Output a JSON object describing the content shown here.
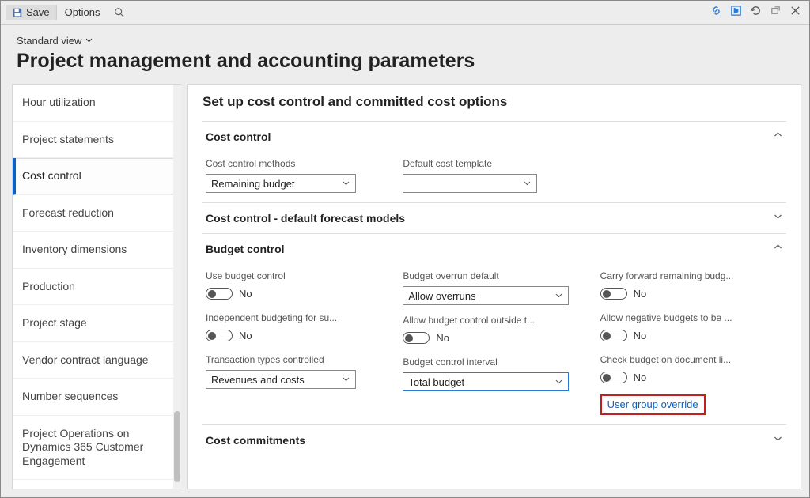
{
  "toolbar": {
    "save_label": "Save",
    "options_label": "Options"
  },
  "header": {
    "view_label": "Standard view",
    "page_title": "Project management and accounting parameters"
  },
  "sidebar": {
    "items": [
      {
        "label": "Hour utilization"
      },
      {
        "label": "Project statements"
      },
      {
        "label": "Cost control",
        "selected": true
      },
      {
        "label": "Forecast reduction"
      },
      {
        "label": "Inventory dimensions"
      },
      {
        "label": "Production"
      },
      {
        "label": "Project stage"
      },
      {
        "label": "Vendor contract language"
      },
      {
        "label": "Number sequences"
      },
      {
        "label": "Project Operations on Dynamics 365 Customer Engagement"
      }
    ]
  },
  "main": {
    "title": "Set up cost control and committed cost options",
    "s1": {
      "title": "Cost control",
      "lbl_methods": "Cost control methods",
      "val_methods": "Remaining budget",
      "lbl_template": "Default cost template",
      "val_template": ""
    },
    "s2": {
      "title": "Cost control - default forecast models"
    },
    "s3": {
      "title": "Budget control",
      "c1": {
        "lbl_use": "Use budget control",
        "val_use": "No",
        "lbl_indep": "Independent budgeting for su...",
        "val_indep": "No",
        "lbl_trans": "Transaction types controlled",
        "val_trans": "Revenues and costs"
      },
      "c2": {
        "lbl_overrun": "Budget overrun default",
        "val_overrun": "Allow overruns",
        "lbl_outside": "Allow budget control outside t...",
        "val_outside": "No",
        "lbl_interval": "Budget control interval",
        "val_interval": "Total budget"
      },
      "c3": {
        "lbl_carry": "Carry forward remaining budg...",
        "val_carry": "No",
        "lbl_neg": "Allow negative budgets to be ...",
        "val_neg": "No",
        "lbl_check": "Check budget on document li...",
        "val_check": "No",
        "link": "User group override"
      }
    },
    "s4": {
      "title": "Cost commitments"
    }
  }
}
